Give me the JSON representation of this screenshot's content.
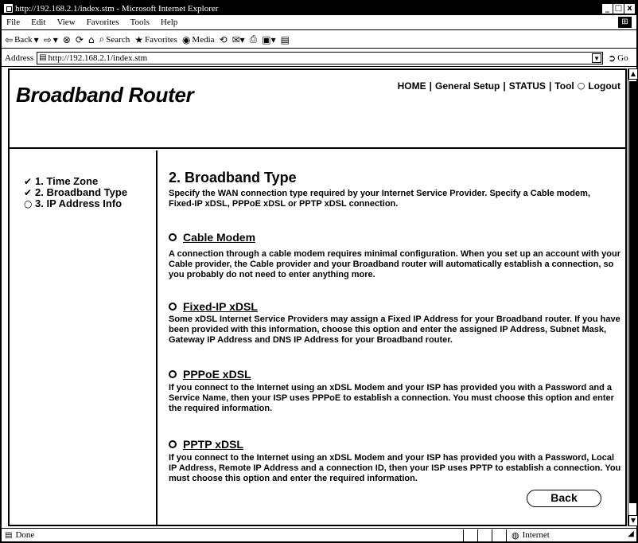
{
  "window": {
    "title": "http://192.168.2.1/index.stm - Microsoft Internet Explorer",
    "controls": [
      "_",
      "□",
      "x"
    ]
  },
  "menu": [
    "File",
    "Edit",
    "View",
    "Favorites",
    "Tools",
    "Help"
  ],
  "toolbar": {
    "back": "Back",
    "search": "Search",
    "favorites": "Favorites",
    "media": "Media"
  },
  "address": {
    "label": "Address",
    "url": "http://192.168.2.1/index.stm",
    "go": "Go"
  },
  "page": {
    "brand": "Broadband Router",
    "nav": [
      "HOME",
      "General Setup",
      "STATUS",
      "Tool",
      "Logout"
    ],
    "steps": [
      {
        "label": "1. Time Zone",
        "state": "done"
      },
      {
        "label": "2. Broadband Type",
        "state": "done"
      },
      {
        "label": "3. IP Address Info",
        "state": "pending"
      }
    ],
    "heading": "2. Broadband Type",
    "intro": "Specify the WAN connection type required by your Internet Service Provider. Specify a Cable modem, Fixed-IP xDSL, PPPoE xDSL or PPTP xDSL connection.",
    "options": [
      {
        "title": "Cable Modem",
        "desc": "A connection through a cable modem requires minimal configuration. When you set up an account with your Cable provider, the Cable provider and your Broadband router will automatically establish a connection, so you probably do not need to enter anything more."
      },
      {
        "title": "Fixed-IP xDSL",
        "desc": "Some xDSL Internet Service Providers may assign a Fixed IP Address for your Broadband router. If you have been provided with this information, choose this option and enter the assigned IP Address, Subnet Mask, Gateway IP Address and DNS IP Address for your Broadband router."
      },
      {
        "title": "PPPoE xDSL",
        "desc": "If you connect to the Internet using an xDSL Modem and your ISP has provided you with a Password and a Service Name, then your ISP uses PPPoE to establish a connection. You must choose this option and enter the required information."
      },
      {
        "title": "PPTP xDSL",
        "desc": "If you connect to the Internet using an xDSL Modem and your ISP has provided you with a Password, Local IP Address, Remote IP Address and a connection ID, then your ISP uses PPTP to establish a connection. You must choose this option and enter the required information."
      }
    ],
    "back_button": "Back"
  },
  "status": {
    "text": "Done",
    "zone": "Internet"
  },
  "icons": {
    "step_done": "checkmark-icon",
    "step_pending": "radio-empty-icon"
  }
}
